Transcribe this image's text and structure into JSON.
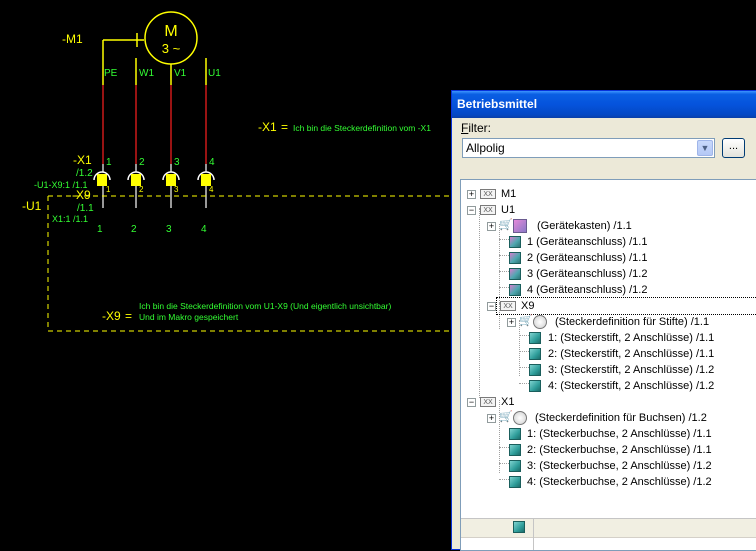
{
  "schematic": {
    "motor": {
      "tag": "-M1",
      "letter": "M",
      "phase": "3 ~",
      "terminals": [
        "PE",
        "W1",
        "V1",
        "U1"
      ]
    },
    "x1": {
      "tag": "-X1",
      "ref": "/1.2",
      "pins": [
        "1",
        "2",
        "3",
        "4"
      ],
      "equals": "=",
      "note_tag": "-X1",
      "note": "Ich bin die Steckerdefinition vom -X1"
    },
    "x9": {
      "tag": "-X9",
      "ref": "/1.1",
      "cross_ref_1": "-U1-X9:1 /1.1",
      "cross_ref_2": "X1:1 /1.1",
      "pins": [
        "1",
        "2",
        "3",
        "4"
      ],
      "note_tag": "-X9",
      "equals": "=",
      "note_line1": "Ich bin die Steckerdefinition vom U1-X9 (Und eigentlich unsichtbar)",
      "note_line2": "Und im Makro gespeichert"
    },
    "u1": {
      "tag": "-U1"
    },
    "colors": {
      "background": "#000000",
      "motor": "#ffff00",
      "label_yellow": "#ffff00",
      "label_green": "#33ff33",
      "wire_red": "#ff2020",
      "wire_white": "#ffffff",
      "plc_box": "#ffff00"
    }
  },
  "dialog": {
    "title": "Betriebsmittel",
    "filter_label_prefix": "F",
    "filter_label_rest": "ilter:",
    "filter_value": "Allpolig",
    "more_button": "...",
    "tree": [
      {
        "label": "M1",
        "icon": "device-tag-icon",
        "level": 0,
        "expander": "+"
      },
      {
        "label": "U1",
        "icon": "device-tag-icon",
        "level": 0,
        "expander": "-"
      },
      {
        "label": "(Geräteкasten) /1.1",
        "icon": "housing-icon",
        "level": 1,
        "expander": "+"
      },
      {
        "label": "1 (Geräteanschluss) /1.1",
        "icon": "device-connection-icon",
        "level": 1
      },
      {
        "label": "2 (Geräteanschluss) /1.1",
        "icon": "device-connection-icon",
        "level": 1
      },
      {
        "label": "3 (Geräteanschluss) /1.2",
        "icon": "device-connection-icon",
        "level": 1
      },
      {
        "label": "4 (Geräteanschluss) /1.2",
        "icon": "device-connection-icon",
        "level": 1
      },
      {
        "label": "X9",
        "icon": "device-tag-icon",
        "level": 1,
        "expander": "-"
      },
      {
        "label": "(Steckerdefinition für Stifte) /1.1",
        "icon": "plug-definition-icon",
        "level": 2,
        "expander": "+"
      },
      {
        "label": "1: (Steckerstift, 2 Anschlüsse) /1.1",
        "icon": "pin-icon",
        "level": 2
      },
      {
        "label": "2: (Steckerstift, 2 Anschlüsse) /1.1",
        "icon": "pin-icon",
        "level": 2
      },
      {
        "label": "3: (Steckerstift, 2 Anschlüsse) /1.2",
        "icon": "pin-icon",
        "level": 2
      },
      {
        "label": "4: (Steckerstift, 2 Anschlüsse) /1.2",
        "icon": "pin-icon",
        "level": 2
      },
      {
        "label": "X1",
        "icon": "device-tag-icon",
        "level": 0,
        "expander": "-"
      },
      {
        "label": "(Steckerdefinition für Buchsen) /1.2",
        "icon": "plug-definition-icon",
        "level": 1,
        "expander": "+"
      },
      {
        "label": "1: (Steckerbuchse, 2 Anschlüsse) /1.1",
        "icon": "socket-icon",
        "level": 1
      },
      {
        "label": "2: (Steckerbuchse, 2 Anschlüsse) /1.1",
        "icon": "socket-icon",
        "level": 1
      },
      {
        "label": "3: (Steckerbuchse, 2 Anschlüsse) /1.2",
        "icon": "socket-icon",
        "level": 1
      },
      {
        "label": "4: (Steckerbuchse, 2 Anschlüsse) /1.2",
        "icon": "socket-icon",
        "level": 1
      }
    ]
  }
}
